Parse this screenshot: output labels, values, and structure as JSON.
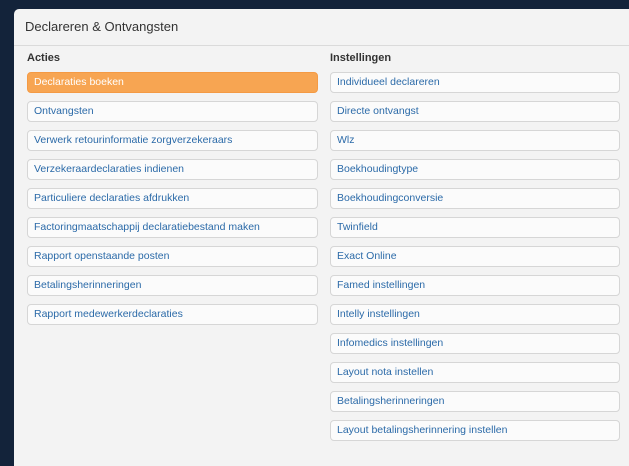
{
  "page": {
    "title": "Declareren & Ontvangsten"
  },
  "acties": {
    "heading": "Acties",
    "items": [
      {
        "label": "Declaraties boeken"
      },
      {
        "label": "Ontvangsten"
      },
      {
        "label": "Verwerk retourinformatie zorgverzekeraars"
      },
      {
        "label": "Verzekeraardeclaraties indienen"
      },
      {
        "label": "Particuliere declaraties afdrukken"
      },
      {
        "label": "Factoringmaatschappij declaratiebestand maken"
      },
      {
        "label": "Rapport openstaande posten"
      },
      {
        "label": "Betalingsherinneringen"
      },
      {
        "label": "Rapport medewerkerdeclaraties"
      }
    ]
  },
  "instellingen": {
    "heading": "Instellingen",
    "items": [
      {
        "label": "Individueel declareren"
      },
      {
        "label": "Directe ontvangst"
      },
      {
        "label": "Wlz"
      },
      {
        "label": "Boekhoudingtype"
      },
      {
        "label": "Boekhoudingconversie"
      },
      {
        "label": "Twinfield"
      },
      {
        "label": "Exact Online"
      },
      {
        "label": "Famed instellingen"
      },
      {
        "label": "Intelly instellingen"
      },
      {
        "label": "Infomedics instellingen"
      },
      {
        "label": "Layout nota instellen"
      },
      {
        "label": "Betalingsherinneringen"
      },
      {
        "label": "Layout betalingsherinnering instellen"
      }
    ]
  },
  "colors": {
    "accent": "#f7a552",
    "link": "#2b6aa8",
    "background": "#13233a"
  }
}
